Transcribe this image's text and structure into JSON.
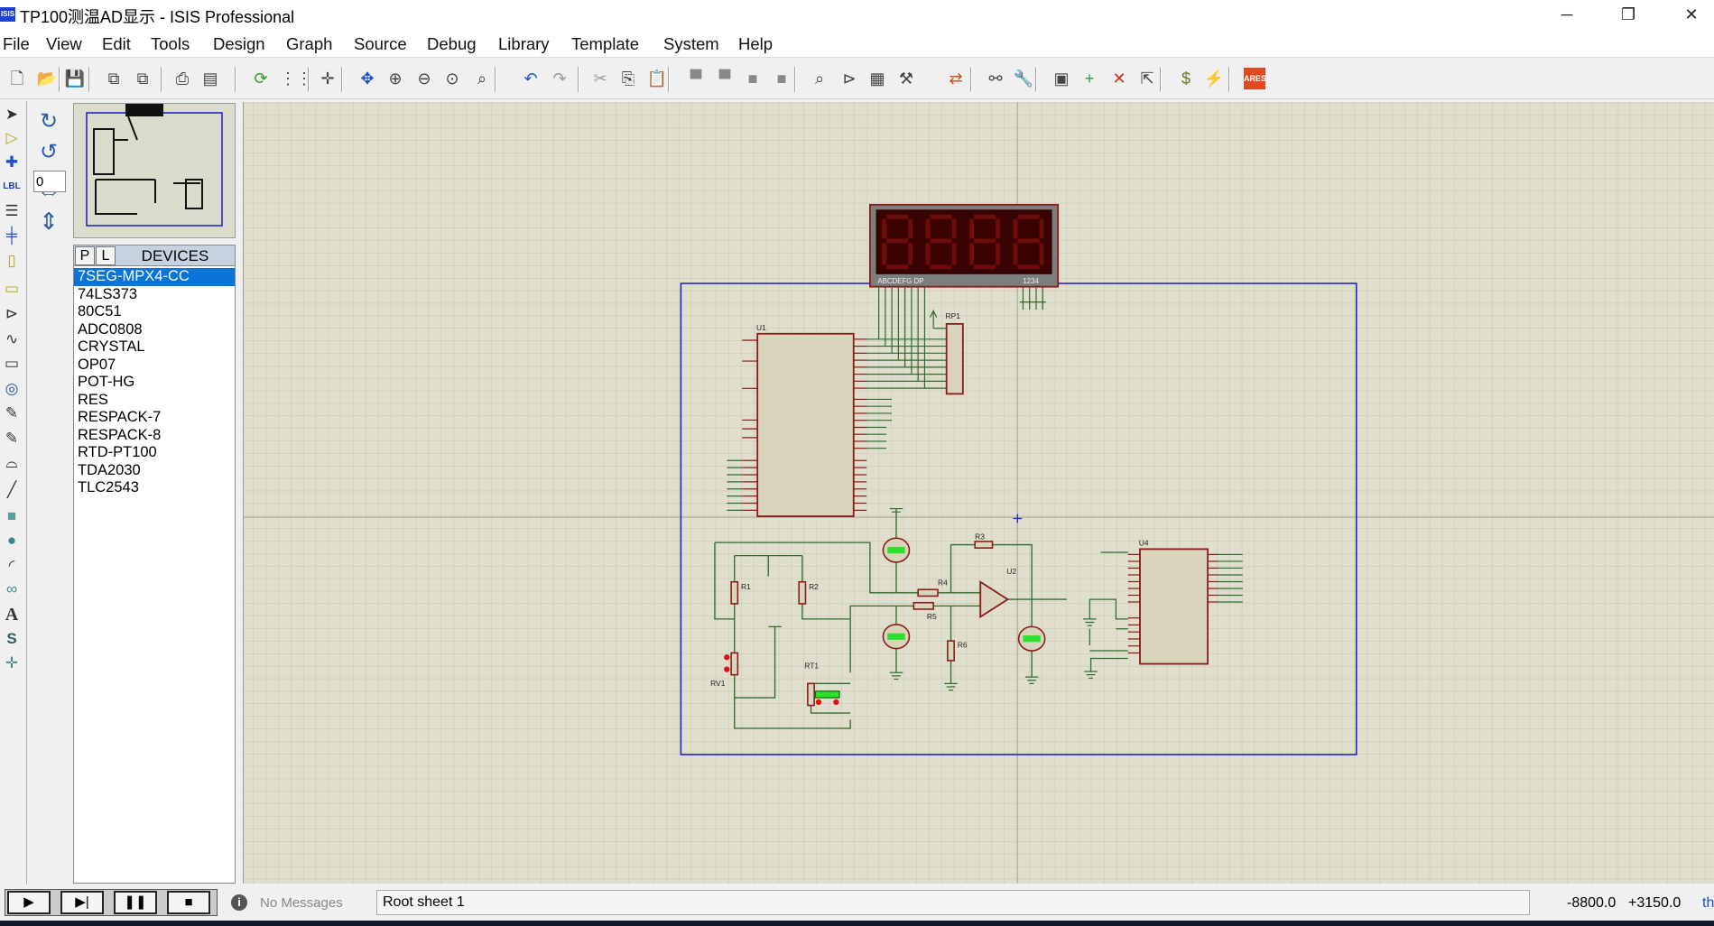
{
  "window": {
    "title": "TP100测温AD显示 - ISIS Professional",
    "app_icon_text": "ISIS",
    "minimize": "─",
    "restore": "❐",
    "close": "✕"
  },
  "menu": [
    "File",
    "View",
    "Edit",
    "Tools",
    "Design",
    "Graph",
    "Source",
    "Debug",
    "Library",
    "Template",
    "System",
    "Help"
  ],
  "toolbar": [
    "new-file-icon",
    "open-folder-icon",
    "save-icon",
    "import-section-icon",
    "export-section-icon",
    "print-icon",
    "page-setup-icon",
    "refresh-icon",
    "grid-toggle-icon",
    "origin-icon",
    "pan-icon",
    "zoom-in-icon",
    "zoom-out-icon",
    "zoom-all-icon",
    "zoom-area-icon",
    "undo-icon",
    "redo-icon",
    "cut-icon",
    "copy-icon",
    "paste-icon",
    "block-copy-icon",
    "block-move-icon",
    "block-rotate-icon",
    "block-delete-icon",
    "pick-device-icon",
    "make-device-icon",
    "package-tool-icon",
    "decompose-icon",
    "wire-autorouter-icon",
    "search-tag-icon",
    "property-assign-icon",
    "new-sheet-icon",
    "add-sheet-icon",
    "remove-sheet-icon",
    "goto-child-icon",
    "bill-of-materials-icon",
    "electrical-rule-check-icon",
    "ares-netlist-icon"
  ],
  "toolbar_ares_label": "ARES",
  "left_tools": [
    "selection-mode-icon",
    "component-mode-icon",
    "junction-dot-icon",
    "wire-label-icon",
    "text-script-icon",
    "bus-icon",
    "subcircuit-icon",
    "terminals-icon",
    "device-pins-icon",
    "graph-mode-icon",
    "tape-recorder-icon",
    "generator-icon",
    "voltage-probe-icon",
    "current-probe-icon",
    "virtual-instruments-icon",
    "line-2d-icon",
    "box-2d-icon",
    "circle-2d-icon",
    "arc-2d-icon",
    "path-2d-icon",
    "text-2d-icon",
    "symbol-2d-icon",
    "marker-2d-icon"
  ],
  "left_tools_labels": {
    "wire_label": "LBL",
    "text_2d": "A",
    "symbol_2d": "S"
  },
  "orientation": {
    "rotation_value": "0"
  },
  "devices": {
    "p_button": "P",
    "l_button": "L",
    "title": "DEVICES",
    "items": [
      "7SEG-MPX4-CC",
      "74LS373",
      "80C51",
      "ADC0808",
      "CRYSTAL",
      "OP07",
      "POT-HG",
      "RES",
      "RESPACK-7",
      "RESPACK-8",
      "RTD-PT100",
      "TDA2030",
      "TLC2543"
    ],
    "selected": "7SEG-MPX4-CC"
  },
  "schematic": {
    "display_segments_label": "ABCDEFG DP",
    "display_digits_label": "1234",
    "refs": {
      "u1": "U1",
      "u2": "U2",
      "u4": "U4",
      "rp1": "RP1",
      "r1": "R1",
      "r2": "R2",
      "r3": "R3",
      "r4": "R4",
      "r5": "R5",
      "r6": "R6",
      "rv1": "RV1",
      "rt1": "RT1"
    },
    "colors": {
      "wire": "#2e6b2e",
      "component": "#8b1a1a",
      "body": "#d9d4bc",
      "sheet_border": "#2020d0",
      "display_bg": "#3a0202",
      "grid": "#c8c7b4"
    }
  },
  "status": {
    "play": "▶",
    "step": "▶|",
    "pause": "❚❚",
    "stop": "■",
    "messages": "No Messages",
    "sheet": "Root sheet 1",
    "coord_x": "-8800.0",
    "coord_y": "+3150.0",
    "unit": "th"
  }
}
